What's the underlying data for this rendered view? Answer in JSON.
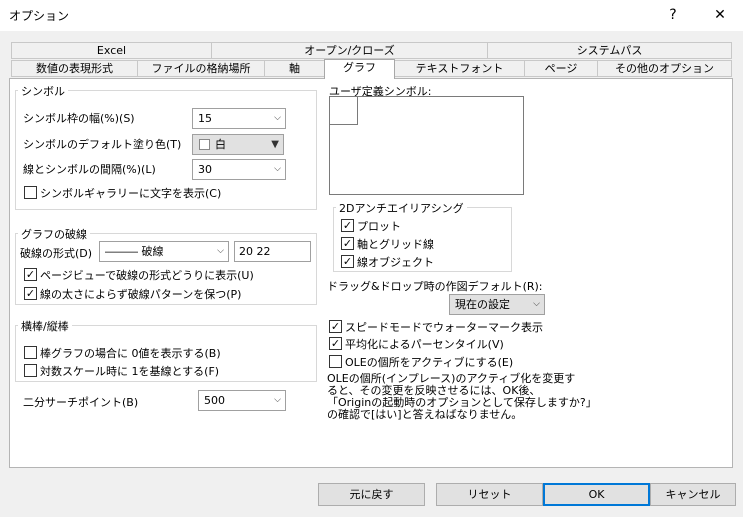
{
  "window": {
    "title": "オプション",
    "help_label": "?",
    "close_label": "✕"
  },
  "tabs": {
    "row1": [
      "Excel",
      "オープン/クローズ",
      "システムパス"
    ],
    "row2": [
      "数値の表現形式",
      "ファイルの格納場所",
      "軸",
      "グラフ",
      "テキストフォント",
      "ページ",
      "その他のオプション"
    ],
    "active": "グラフ"
  },
  "symbol": {
    "group_title": "シンボル",
    "frame_width_label": "シンボル枠の幅(%)(S)",
    "frame_width_value": "15",
    "fill_color_label": "シンボルのデフォルト塗り色(T)",
    "fill_color_value": "白",
    "gap_label": "線とシンボルの間隔(%)(L)",
    "gap_value": "30",
    "gallery_text_label": "シンボルギャラリーに文字を表示(C)"
  },
  "break": {
    "group_title": "グラフの破線",
    "format_label": "破線の形式(D)",
    "format_value": "――― 破線",
    "pattern_value": "20 22",
    "pageview_label": "ページビューで破線の形式どうりに表示(U)",
    "keep_pattern_label": "線の太さによらず破線パターンを保つ(P)"
  },
  "bar": {
    "group_title": "横棒/縦棒",
    "show_zero_label": "棒グラフの場合に 0値を表示する(B)",
    "log_base_label": "対数スケール時に 1を基線とする(F)"
  },
  "binary_search": {
    "label": "二分サーチポイント(B)",
    "value": "500"
  },
  "user_symbol": {
    "label": "ユーザ定義シンボル:"
  },
  "antialias": {
    "group_title": "2Dアンチエイリアシング",
    "plot_label": "プロット",
    "axis_grid_label": "軸とグリッド線",
    "line_object_label": "線オブジェクト"
  },
  "drag_drop": {
    "label": "ドラッグ&ドロップ時の作図デフォルト(R):",
    "value": "現在の設定"
  },
  "options": {
    "speed_mode_label": "スピードモードでウォーターマーク表示",
    "smooth_percentile_label": "平均化によるパーセンタイル(V)",
    "ole_activate_label": "OLEの個所をアクティブにする(E)",
    "ole_note_lines": [
      "OLEの個所(インプレース)のアクティブ化を変更す",
      "ると、その変更を反映させるには、OK後、",
      "「Originの起動時のオプションとして保存しますか?」",
      "の確認で[はい]と答えねばなりません。"
    ]
  },
  "buttons": {
    "revert": "元に戻す",
    "reset": "リセット",
    "ok": "OK",
    "cancel": "キャンセル"
  }
}
